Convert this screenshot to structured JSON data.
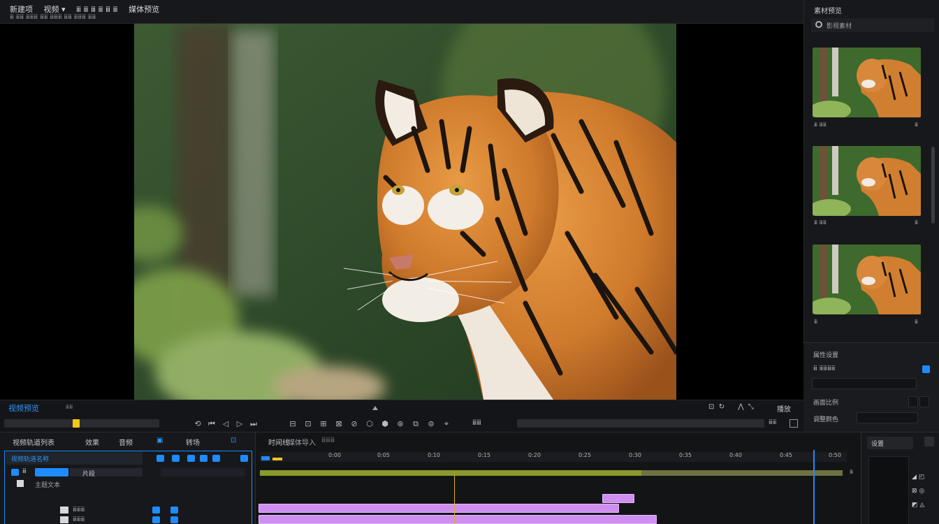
{
  "topbar": {
    "menu": [
      "新建项",
      "视频 ▾",
      "ⅲ ⅲ ⅲ ⅲ ⅲ ⅲ",
      "媒体预览"
    ],
    "subline": "ⅲ ⅲⅲ ⅲⅲⅲ ⅲⅲ ⅲⅲⅲ ⅲⅲ ⅲⅲⅲ ⅲⅲ"
  },
  "preview_panel": {
    "title": "素材预览",
    "subtitle": "影视素材",
    "thumbnails": [
      {
        "caption": "ⅲ ⅲⅲ",
        "duration": "ⅲ"
      },
      {
        "caption": "ⅲ ⅲⅲ",
        "duration": "ⅲ"
      },
      {
        "caption": "ⅲ",
        "duration": "ⅲ"
      }
    ]
  },
  "inspector": {
    "title": "属性设置",
    "row1": "ⅲ ⅲⅲⅲⅲ",
    "row2": "画面比例",
    "row3": "调整颜色",
    "toggle_checked": true,
    "accent": "#1f8bff"
  },
  "transport": {
    "clip_name": "视频预览",
    "label": "ⅲⅲ",
    "right_label": "播放",
    "right_label2": "ⅲⅲ",
    "buttons": [
      "⟲",
      "⏮",
      "◁",
      "▷",
      "⏭",
      "⊟",
      "⊡",
      "⊞",
      "⊠",
      "⊘",
      "⬡",
      "⬢",
      "⊛",
      "⧉",
      "⊜",
      "⌖"
    ]
  },
  "track_panel": {
    "headers": [
      "视频轨道列表",
      "效果",
      "音频",
      "▣",
      "转场",
      "⊡"
    ],
    "track_name": "视频轨道名称",
    "row_label": "ⅲ",
    "row_label2": "片段",
    "sub_label": "主题文本",
    "rows": [
      {
        "label": "ⅲⅲⅲ"
      },
      {
        "label": "ⅲⅲⅲ"
      }
    ]
  },
  "timeline": {
    "tabs": [
      "时间线",
      "媒体导入",
      "ⅲⅲⅲ"
    ],
    "ticks": [
      "0:00",
      "0:05",
      "0:10",
      "0:15",
      "0:20",
      "0:25",
      "0:30",
      "0:35",
      "0:40",
      "0:45",
      "0:50"
    ],
    "end_label": "ⅲ"
  },
  "bottom_right": {
    "title": "设置"
  }
}
